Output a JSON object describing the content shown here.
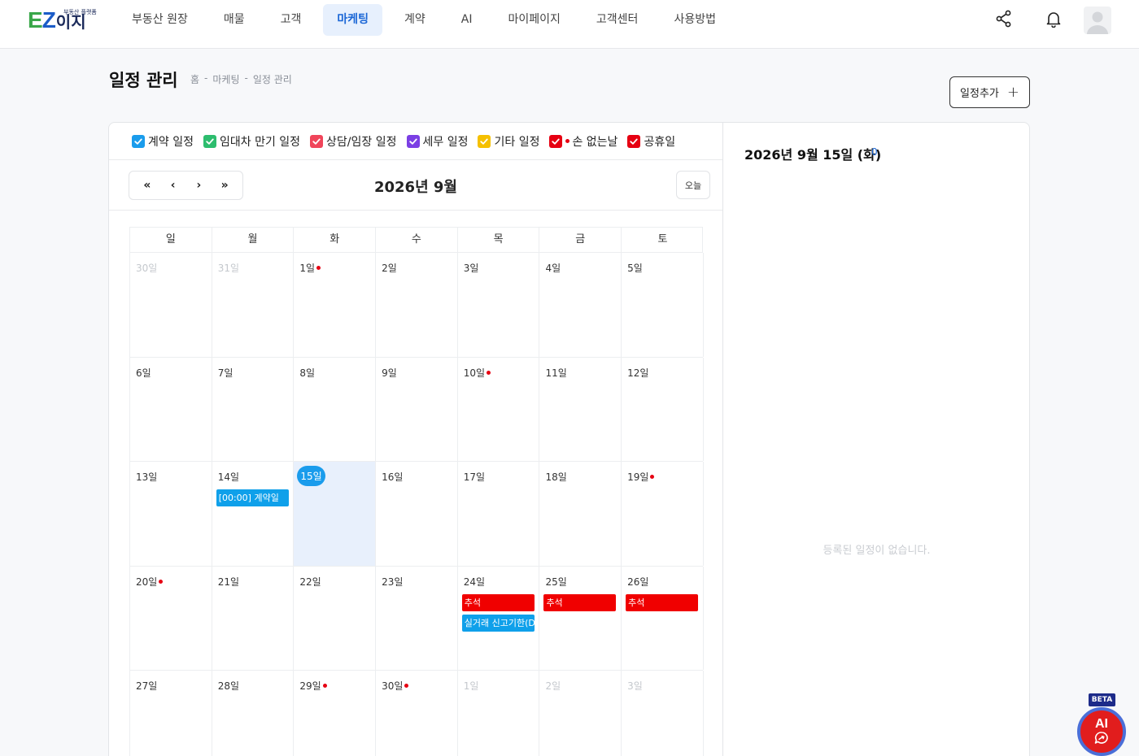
{
  "header": {
    "logo_ez": "EZ",
    "logo_kr": "이지",
    "logo_small": "부동산 플랫폼",
    "nav": [
      "부동산 원장",
      "매물",
      "고객",
      "마케팅",
      "계약",
      "AI",
      "마이페이지",
      "고객센터",
      "사용방법"
    ],
    "active_nav": "마케팅"
  },
  "page": {
    "title": "일정 관리",
    "breadcrumb": [
      "홈",
      "-",
      "마케팅",
      "-",
      "일정 관리"
    ],
    "add_button": "일정추가",
    "add_icon": "+"
  },
  "filters": [
    {
      "label": "계약 일정",
      "color": "#1a9cec",
      "dot": false
    },
    {
      "label": "임대차 만기 일정",
      "color": "#2dbd6e",
      "dot": false
    },
    {
      "label": "상담/임장 일정",
      "color": "#f0455a",
      "dot": false
    },
    {
      "label": "세무 일정",
      "color": "#7b3fe4",
      "dot": false
    },
    {
      "label": "기타 일정",
      "color": "#f5c000",
      "dot": false
    },
    {
      "label": "손 없는날",
      "color": "#e60012",
      "dot": true
    },
    {
      "label": "공휴일",
      "color": "#e60012",
      "dot": false
    }
  ],
  "calendar": {
    "month_title": "2026년 9월",
    "nav_icons": [
      "«",
      "‹",
      "›",
      "»"
    ],
    "today_label": "오늘",
    "weekdays": [
      "일",
      "월",
      "화",
      "수",
      "목",
      "금",
      "토"
    ],
    "weeks": [
      [
        {
          "label": "30일",
          "muted": true
        },
        {
          "label": "31일",
          "muted": true
        },
        {
          "label": "1일",
          "dot": true
        },
        {
          "label": "2일"
        },
        {
          "label": "3일"
        },
        {
          "label": "4일"
        },
        {
          "label": "5일"
        }
      ],
      [
        {
          "label": "6일"
        },
        {
          "label": "7일"
        },
        {
          "label": "8일"
        },
        {
          "label": "9일"
        },
        {
          "label": "10일",
          "dot": true
        },
        {
          "label": "11일"
        },
        {
          "label": "12일"
        }
      ],
      [
        {
          "label": "13일"
        },
        {
          "label": "14일",
          "events": [
            {
              "text": "[00:00]   계약일",
              "color": "blue"
            }
          ]
        },
        {
          "label": "15일",
          "today": true
        },
        {
          "label": "16일"
        },
        {
          "label": "17일"
        },
        {
          "label": "18일"
        },
        {
          "label": "19일",
          "dot": true
        }
      ],
      [
        {
          "label": "20일",
          "dot": true
        },
        {
          "label": "21일"
        },
        {
          "label": "22일"
        },
        {
          "label": "23일"
        },
        {
          "label": "24일",
          "events": [
            {
              "text": "추석",
              "color": "red"
            },
            {
              "text": "실거래 신고기한(D",
              "color": "blue"
            }
          ]
        },
        {
          "label": "25일",
          "events": [
            {
              "text": "추석",
              "color": "red"
            }
          ]
        },
        {
          "label": "26일",
          "events": [
            {
              "text": "추석",
              "color": "red"
            }
          ]
        }
      ],
      [
        {
          "label": "27일"
        },
        {
          "label": "28일"
        },
        {
          "label": "29일",
          "dot": true
        },
        {
          "label": "30일",
          "dot": true
        },
        {
          "label": "1일",
          "muted": true
        },
        {
          "label": "2일",
          "muted": true
        },
        {
          "label": "3일",
          "muted": true
        }
      ]
    ]
  },
  "side": {
    "selected_date": "2026년 9월 15일 (화)",
    "count": "0",
    "empty_text": "등록된 일정이 없습니다."
  },
  "ai": {
    "beta": "BETA",
    "label": "AI"
  }
}
